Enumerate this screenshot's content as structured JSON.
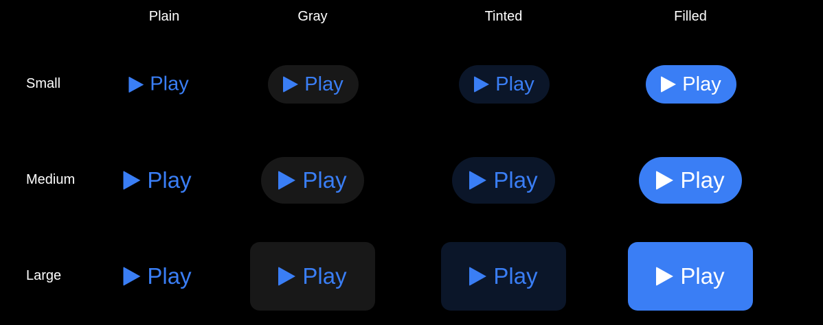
{
  "columns": {
    "plain": "Plain",
    "gray": "Gray",
    "tinted": "Tinted",
    "filled": "Filled"
  },
  "rows": {
    "small": "Small",
    "medium": "Medium",
    "large": "Large"
  },
  "button": {
    "label": "Play",
    "icon": "play-icon"
  },
  "colors": {
    "background": "#000000",
    "accent": "#3a7ef5",
    "gray_fill": "#181818",
    "tinted_fill": "#0b1629",
    "text_primary": "#ffffff"
  }
}
